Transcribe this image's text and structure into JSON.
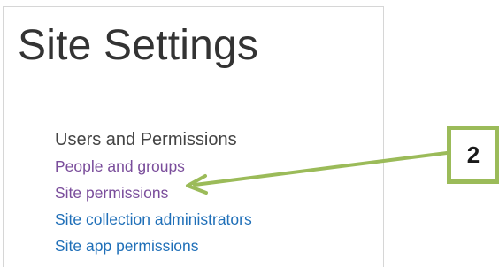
{
  "page_title": "Site Settings",
  "section": {
    "heading": "Users and Permissions",
    "links": [
      {
        "label": "People and groups",
        "state": "visited"
      },
      {
        "label": "Site permissions",
        "state": "visited"
      },
      {
        "label": "Site collection administrators",
        "state": "normal"
      },
      {
        "label": "Site app permissions",
        "state": "normal"
      }
    ]
  },
  "callout": {
    "number": "2",
    "color": "#9bbb59"
  },
  "colors": {
    "visited_link": "#7a4d9b",
    "link": "#1f6fb8",
    "heading": "#444444",
    "annotation": "#9bbb59"
  }
}
